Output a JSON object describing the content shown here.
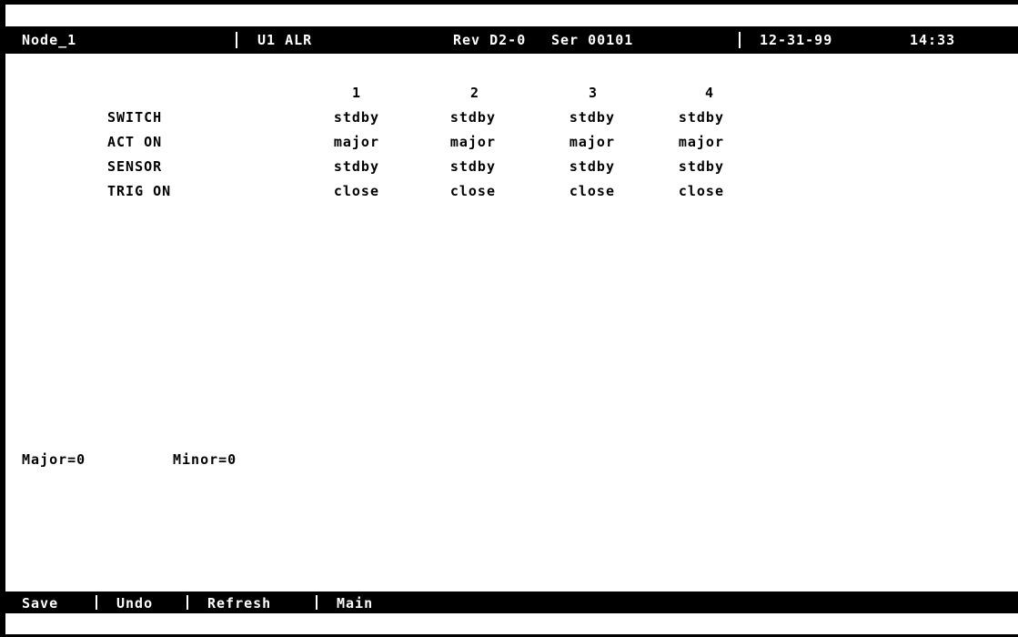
{
  "header": {
    "node": "Node_1",
    "module": "U1 ALR",
    "revision": "Rev D2-0",
    "serial": "Ser 00101",
    "date": "12-31-99",
    "time": "14:33"
  },
  "grid": {
    "columns": [
      "1",
      "2",
      "3",
      "4"
    ],
    "rows": [
      {
        "label": "SWITCH",
        "values": [
          "stdby",
          "stdby",
          "stdby",
          "stdby"
        ]
      },
      {
        "label": "ACT ON",
        "values": [
          "major",
          "major",
          "major",
          "major"
        ]
      },
      {
        "label": "SENSOR",
        "values": [
          "stdby",
          "stdby",
          "stdby",
          "stdby"
        ]
      },
      {
        "label": "TRIG ON",
        "values": [
          "close",
          "close",
          "close",
          "close"
        ]
      }
    ]
  },
  "alarms": {
    "major": "Major=0",
    "minor": "Minor=0"
  },
  "commands": {
    "save": "Save",
    "undo": "Undo",
    "refresh": "Refresh",
    "main": "Main"
  }
}
